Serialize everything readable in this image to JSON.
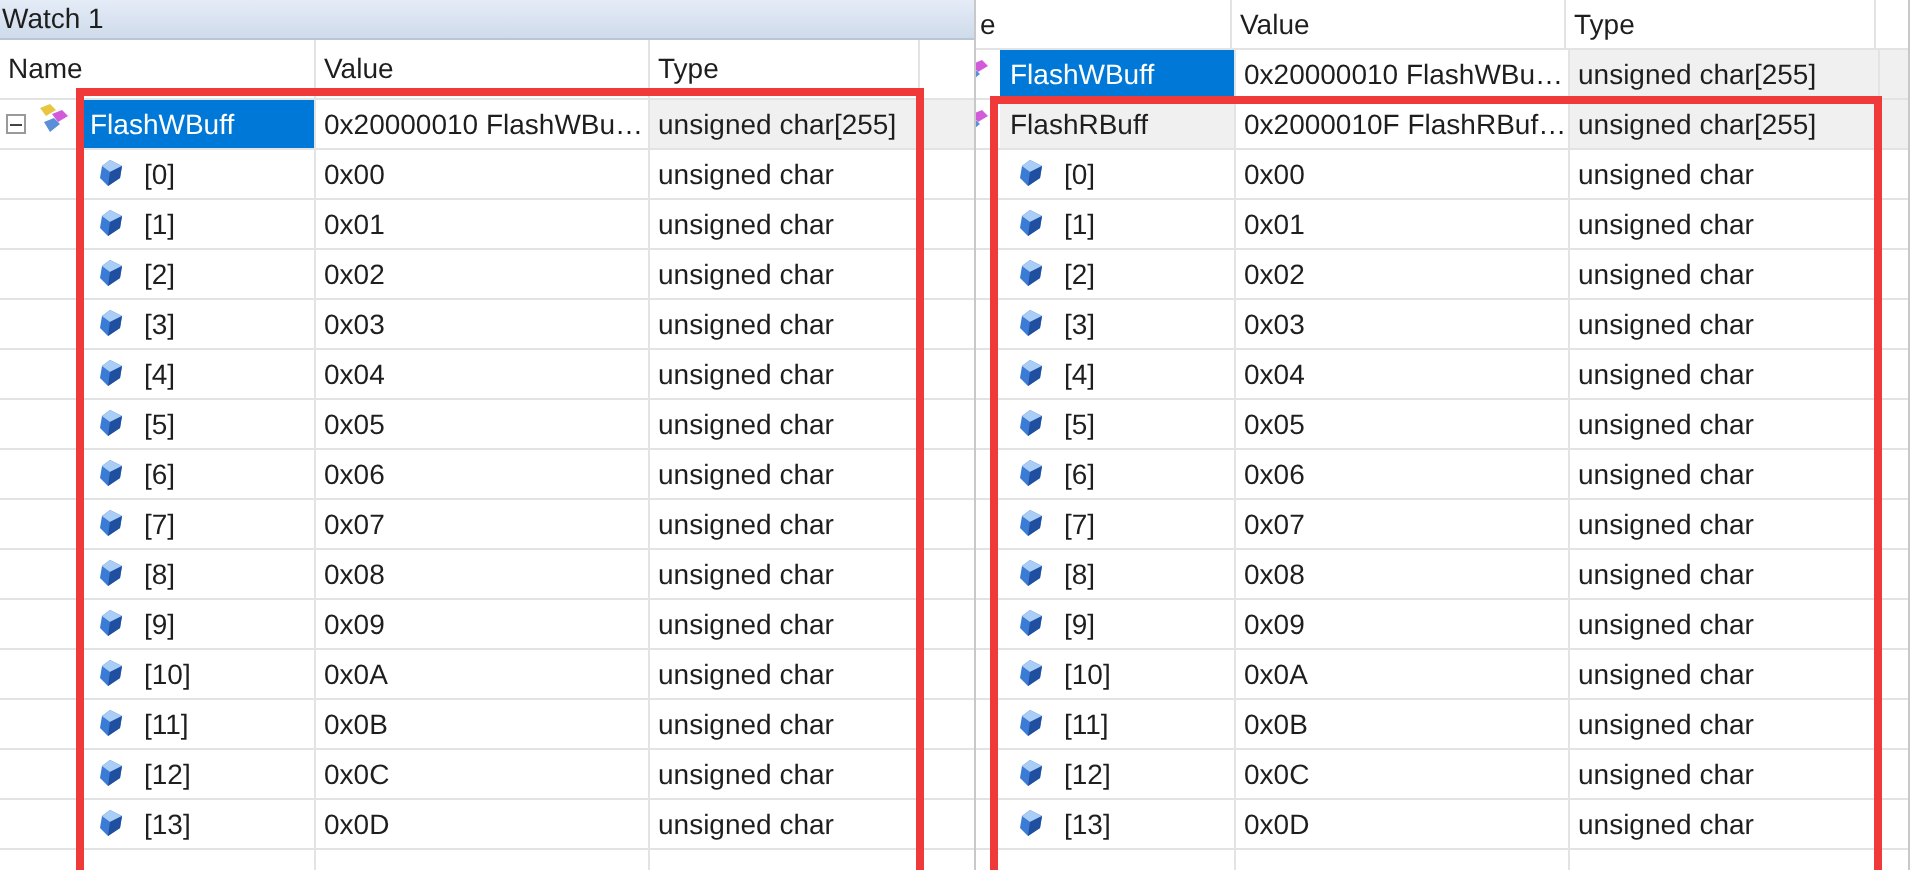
{
  "panels": [
    {
      "title": "Watch 1",
      "outlined": true,
      "columns": [
        "Name",
        "Value",
        "Type"
      ],
      "rows": [
        {
          "kind": "array",
          "name": "FlashWBuff",
          "value": "0x20000010 FlashWBu…",
          "type": "unsigned char[255]",
          "selected": true,
          "expanded": true,
          "children": [
            {
              "name": "[0]",
              "value": "0x00",
              "type": "unsigned char"
            },
            {
              "name": "[1]",
              "value": "0x01",
              "type": "unsigned char"
            },
            {
              "name": "[2]",
              "value": "0x02",
              "type": "unsigned char"
            },
            {
              "name": "[3]",
              "value": "0x03",
              "type": "unsigned char"
            },
            {
              "name": "[4]",
              "value": "0x04",
              "type": "unsigned char"
            },
            {
              "name": "[5]",
              "value": "0x05",
              "type": "unsigned char"
            },
            {
              "name": "[6]",
              "value": "0x06",
              "type": "unsigned char"
            },
            {
              "name": "[7]",
              "value": "0x07",
              "type": "unsigned char"
            },
            {
              "name": "[8]",
              "value": "0x08",
              "type": "unsigned char"
            },
            {
              "name": "[9]",
              "value": "0x09",
              "type": "unsigned char"
            },
            {
              "name": "[10]",
              "value": "0x0A",
              "type": "unsigned char"
            },
            {
              "name": "[11]",
              "value": "0x0B",
              "type": "unsigned char"
            },
            {
              "name": "[12]",
              "value": "0x0C",
              "type": "unsigned char"
            },
            {
              "name": "[13]",
              "value": "0x0D",
              "type": "unsigned char"
            }
          ]
        }
      ]
    },
    {
      "outlined": true,
      "columns": [
        "e",
        "Value",
        "Type"
      ],
      "rows": [
        {
          "kind": "array",
          "name": "FlashWBuff",
          "value": "0x20000010 FlashWBu…",
          "type": "unsigned char[255]",
          "selected": true
        },
        {
          "kind": "array",
          "name": "FlashRBuff",
          "value": "0x2000010F FlashRBuf…",
          "type": "unsigned char[255]",
          "selected": false,
          "children": [
            {
              "name": "[0]",
              "value": "0x00",
              "type": "unsigned char"
            },
            {
              "name": "[1]",
              "value": "0x01",
              "type": "unsigned char"
            },
            {
              "name": "[2]",
              "value": "0x02",
              "type": "unsigned char"
            },
            {
              "name": "[3]",
              "value": "0x03",
              "type": "unsigned char"
            },
            {
              "name": "[4]",
              "value": "0x04",
              "type": "unsigned char"
            },
            {
              "name": "[5]",
              "value": "0x05",
              "type": "unsigned char"
            },
            {
              "name": "[6]",
              "value": "0x06",
              "type": "unsigned char"
            },
            {
              "name": "[7]",
              "value": "0x07",
              "type": "unsigned char"
            },
            {
              "name": "[8]",
              "value": "0x08",
              "type": "unsigned char"
            },
            {
              "name": "[9]",
              "value": "0x09",
              "type": "unsigned char"
            },
            {
              "name": "[10]",
              "value": "0x0A",
              "type": "unsigned char"
            },
            {
              "name": "[11]",
              "value": "0x0B",
              "type": "unsigned char"
            },
            {
              "name": "[12]",
              "value": "0x0C",
              "type": "unsigned char"
            },
            {
              "name": "[13]",
              "value": "0x0D",
              "type": "unsigned char"
            }
          ]
        }
      ]
    }
  ]
}
